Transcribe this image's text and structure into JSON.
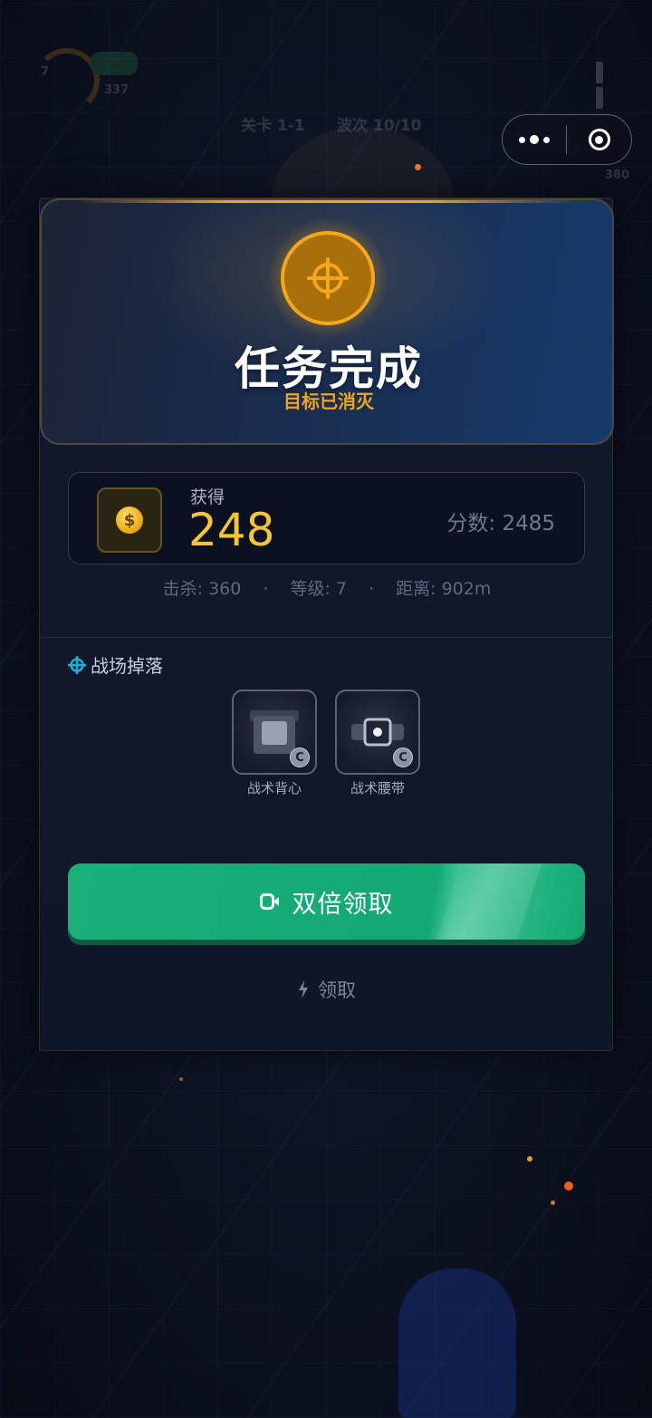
{
  "background": {
    "hud_number": "337",
    "hud_small": "7",
    "level_label": "关卡 1-1",
    "wave_label": "波次 10/10",
    "hud_right": "380"
  },
  "capsule": {
    "more_icon": "more-dots-icon",
    "close_icon": "target-circle-icon"
  },
  "result": {
    "icon": "crosshair-icon",
    "title": "任务完成",
    "subtitle": "目标已消灭",
    "gain_label": "获得",
    "gain_value": "248",
    "score_text": "分数: 2485",
    "stats": {
      "kills": "击杀: 360",
      "level": "等级: 7",
      "distance": "距离: 902m",
      "separator": "·"
    }
  },
  "loot": {
    "title": "战场掉落",
    "items": [
      {
        "name": "战术背心",
        "rarity": "C",
        "icon": "vest-icon"
      },
      {
        "name": "战术腰带",
        "rarity": "C",
        "icon": "belt-icon"
      }
    ]
  },
  "buttons": {
    "double_claim": "双倍领取",
    "claim": "领取"
  },
  "colors": {
    "accent_gold": "#f4a817",
    "primary_green": "#14a874",
    "coin_yellow": "#f7c531"
  }
}
